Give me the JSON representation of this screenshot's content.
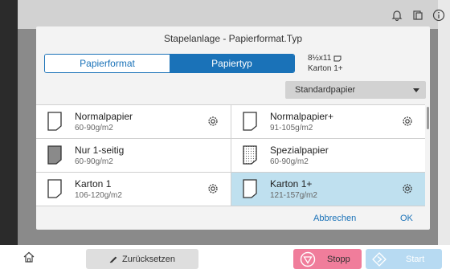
{
  "dialog": {
    "title": "Stapelanlage - Papierformat.Typ",
    "tabs": [
      "Papierformat",
      "Papiertyp"
    ],
    "paper_size": "8½x11",
    "paper_type": "Karton 1+",
    "dropdown_value": "Standardpapier",
    "papers": [
      {
        "name": "Normalpapier",
        "weight": "60-90g/m2"
      },
      {
        "name": "Normalpapier+",
        "weight": "91-105g/m2"
      },
      {
        "name": "Nur 1-seitig",
        "weight": "60-90g/m2"
      },
      {
        "name": "Spezialpapier",
        "weight": "60-90g/m2"
      },
      {
        "name": "Karton 1",
        "weight": "106-120g/m2"
      },
      {
        "name": "Karton 1+",
        "weight": "121-157g/m2"
      }
    ],
    "cancel_label": "Abbrechen",
    "ok_label": "OK"
  },
  "bottom": {
    "reset_label": "Zurücksetzen",
    "stop_label": "Stopp",
    "start_label": "Start"
  },
  "colors": {
    "accent": "#1a72b8",
    "selected": "#bfe0ef",
    "stop": "#f07d9b",
    "start": "#b7daf2"
  },
  "icons": [
    "bell-icon",
    "copy-status-icon",
    "info-icon",
    "paper-icon",
    "gear-icon",
    "home-icon",
    "pencil-icon",
    "stop-icon",
    "start-icon",
    "orientation-icon"
  ]
}
